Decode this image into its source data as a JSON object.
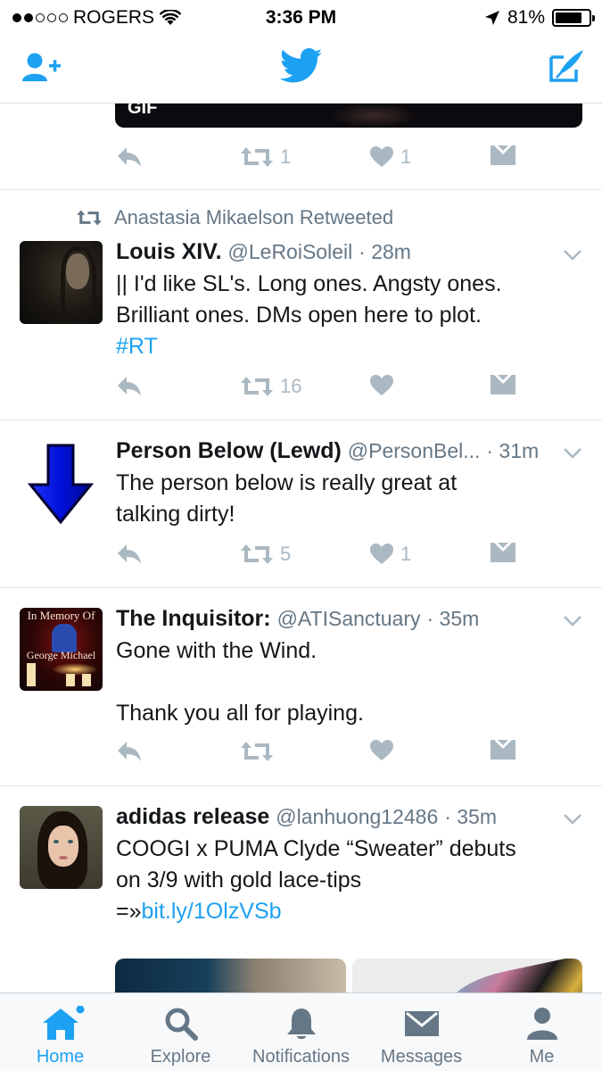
{
  "status_bar": {
    "carrier": "ROGERS",
    "time": "3:36 PM",
    "battery": "81%",
    "battery_level": 0.81
  },
  "nav": {
    "add_user_icon": "add-user-icon",
    "logo_icon": "twitter-bird-icon",
    "compose_icon": "compose-icon"
  },
  "tweets": [
    {
      "media_badge": "GIF",
      "retweets": "1",
      "likes": "1"
    },
    {
      "retweeted_by": "Anastasia Mikaelson Retweeted",
      "name": "Louis XIV.",
      "handle": "@LeRoiSoleil",
      "time": "· 28m",
      "text_lines": [
        "|| I'd like SL's. Long ones. Angsty ones.",
        "Brilliant ones. DMs open here to plot."
      ],
      "hashtag": "#RT",
      "retweets": "16",
      "likes": ""
    },
    {
      "name": "Person Below (Lewd)",
      "handle": "@PersonBel...",
      "time": "· 31m",
      "text_lines": [
        "The person below is really great at",
        "talking dirty!"
      ],
      "retweets": "5",
      "likes": "1"
    },
    {
      "name": "The Inquisitor:",
      "handle": "@ATISanctuary",
      "time": "· 35m",
      "text_lines": [
        "Gone with the Wind.",
        "",
        "Thank you all for playing."
      ],
      "avatar_text_top": "In Memory Of",
      "avatar_text_bottom": "George Michael",
      "retweets": "",
      "likes": ""
    },
    {
      "name": "adidas release",
      "handle": "@lanhuong12486",
      "time": "· 35m",
      "text_lines": [
        "COOGI x PUMA Clyde “Sweater” debuts",
        "on 3/9 with gold lace-tips"
      ],
      "link_prefix": "=»",
      "link": "bit.ly/1OlzVSb"
    }
  ],
  "tabs": [
    {
      "label": "Home",
      "icon": "home-icon",
      "active": true
    },
    {
      "label": "Explore",
      "icon": "search-icon",
      "active": false
    },
    {
      "label": "Notifications",
      "icon": "bell-icon",
      "active": false
    },
    {
      "label": "Messages",
      "icon": "envelope-icon",
      "active": false
    },
    {
      "label": "Me",
      "icon": "person-icon",
      "active": false
    }
  ],
  "colors": {
    "accent": "#1da1f2",
    "action_gray": "#aab8c2",
    "secondary_text": "#657786"
  }
}
